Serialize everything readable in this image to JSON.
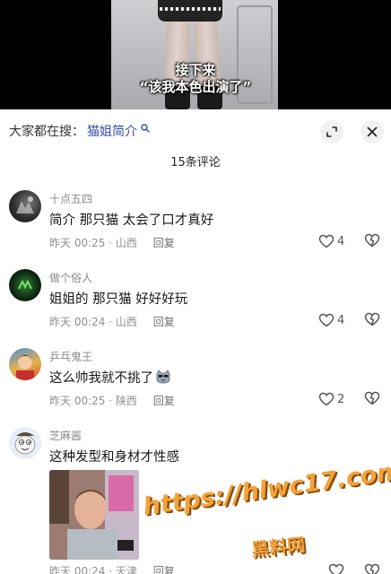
{
  "video": {
    "subtitle_line1": "接下来",
    "subtitle_line2": "“该我本色出演了”"
  },
  "search": {
    "prefix": "大家都在搜：",
    "term": "猫姐简介",
    "icon": "search-icon"
  },
  "header": {
    "comment_count": "15条评论",
    "expand_icon": "expand-icon",
    "close_icon": "close-icon"
  },
  "comments": [
    {
      "username": "十点五四",
      "text": "简介 那只猫 太会了口才真好",
      "time": "昨天 00:25",
      "location": "山西",
      "reply_label": "回复",
      "likes": "4"
    },
    {
      "username": "做个俗人",
      "text": "姐姐的 那只猫 好好好玩",
      "time": "昨天 00:24",
      "location": "山西",
      "reply_label": "回复",
      "likes": "4"
    },
    {
      "username": "乒乓鬼王",
      "text": "这么帅我就不挑了",
      "time": "昨天 00:25",
      "location": "陕西",
      "reply_label": "回复",
      "likes": "2"
    },
    {
      "username": "芝麻酱",
      "text": "这种发型和身材才性感",
      "time": "昨天 00:24",
      "location": "天津",
      "reply_label": "回复",
      "likes": ""
    }
  ],
  "watermark": {
    "url": "https://hlwc17.com",
    "name": "黑料网"
  },
  "colors": {
    "search_term": "#2f4fa6",
    "watermark": "#f3a23a",
    "meta_gray": "#8f8f8f"
  }
}
